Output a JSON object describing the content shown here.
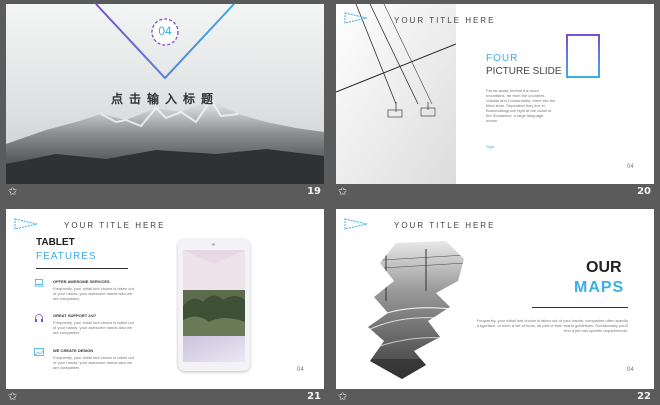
{
  "slides": [
    {
      "number": "19",
      "badge": "04",
      "title": "点击输入标题"
    },
    {
      "number": "20",
      "header": "YOUR TITLE HERE",
      "heading_line1": "FOUR",
      "heading_line2": "PICTURE SLIDE",
      "body": "Far far away, behind the word mountains, far from the countries Vokalia and Consonantia, there live the blind texts. Separated they live in Bookmarksgrove right at the coast of the Semantics, a large language ocean.",
      "link": "Sign",
      "page": "04"
    },
    {
      "number": "21",
      "header": "YOUR TITLE HERE",
      "heading_line1": "TABLET",
      "heading_line2": "FEATURES",
      "features": [
        {
          "title": "OFFER AWESOME SERVICES",
          "text": "Frequently, your initial font choice is taken out of your hands: your awesome hands also we are companies"
        },
        {
          "title": "GREAT SUPPORT 24/7",
          "text": "Frequently, your initial font choice is taken out of your hands: your awesome hands also we are companies"
        },
        {
          "title": "WE CREATE DESIGN",
          "text": "Frequently, your initial font choice is taken out of your hands: your awesome hands also we are companies"
        }
      ],
      "page": "04"
    },
    {
      "number": "22",
      "header": "YOUR TITLE HERE",
      "heading_line1": "OUR",
      "heading_line2": "MAPS",
      "body": "Frequently, your initial font choice is taken out of your hands: companies often specify a typeface, or even a set of fonts, as part of their brand guidelines. Occasionally you'll find a job has specific requirements.",
      "page": "04"
    }
  ],
  "colors": {
    "accent_blue": "#3aaee6",
    "accent_purple": "#7b4fd0",
    "background": "#5b5b5b"
  },
  "icons": [
    "star-icon",
    "flag-icon",
    "laptop-icon",
    "headphones-icon",
    "image-icon"
  ]
}
